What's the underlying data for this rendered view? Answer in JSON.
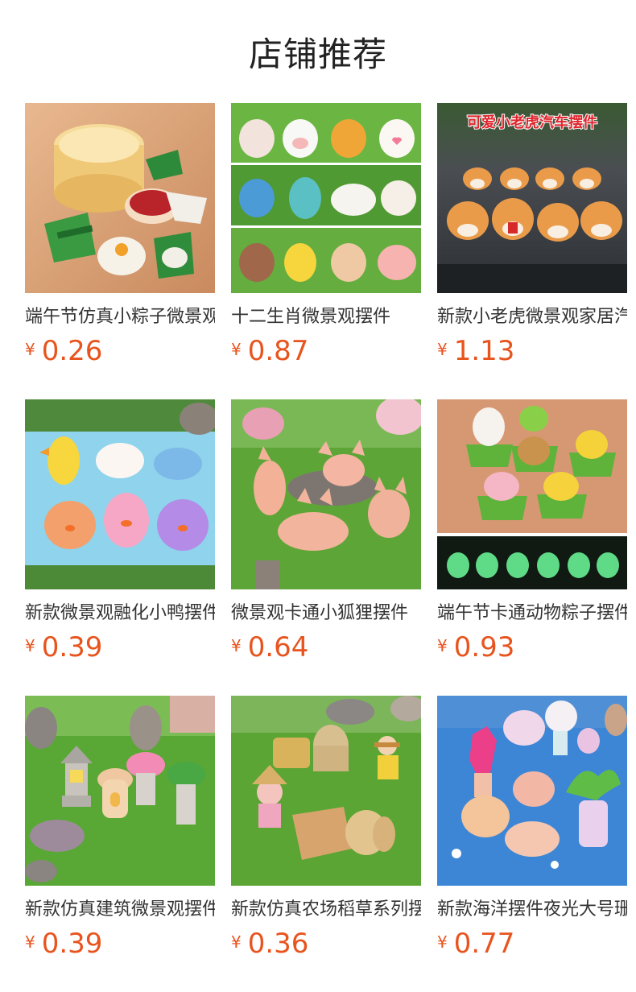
{
  "page": {
    "title": "店铺推荐"
  },
  "colors": {
    "price": "#e8541e",
    "text": "#333333",
    "background": "#ffffff"
  },
  "products": [
    {
      "name": "端午节仿真小粽子微景观摆件",
      "currency": "¥",
      "price": "0.26",
      "image": "zongzi-miniatures"
    },
    {
      "name": "十二生肖微景观摆件",
      "currency": "¥",
      "price": "0.87",
      "image": "zodiac-animals"
    },
    {
      "name": "新款小老虎微景观家居汽车摆件",
      "currency": "¥",
      "price": "1.13",
      "image": "tiger-figures",
      "image_text": "可爱小老虎汽车摆件"
    },
    {
      "name": "新款微景观融化小鸭摆件",
      "currency": "¥",
      "price": "0.39",
      "image": "melting-ducks"
    },
    {
      "name": "微景观卡通小狐狸摆件",
      "currency": "¥",
      "price": "0.64",
      "image": "cartoon-foxes"
    },
    {
      "name": "端午节卡通动物粽子摆件",
      "currency": "¥",
      "price": "0.93",
      "image": "animal-zongzi"
    },
    {
      "name": "新款仿真建筑微景观摆件",
      "currency": "¥",
      "price": "0.39",
      "image": "garden-buildings"
    },
    {
      "name": "新款仿真农场稻草系列摆件",
      "currency": "¥",
      "price": "0.36",
      "image": "farm-haystacks"
    },
    {
      "name": "新款海洋摆件夜光大号珊瑚",
      "currency": "¥",
      "price": "0.77",
      "image": "ocean-coral"
    }
  ]
}
